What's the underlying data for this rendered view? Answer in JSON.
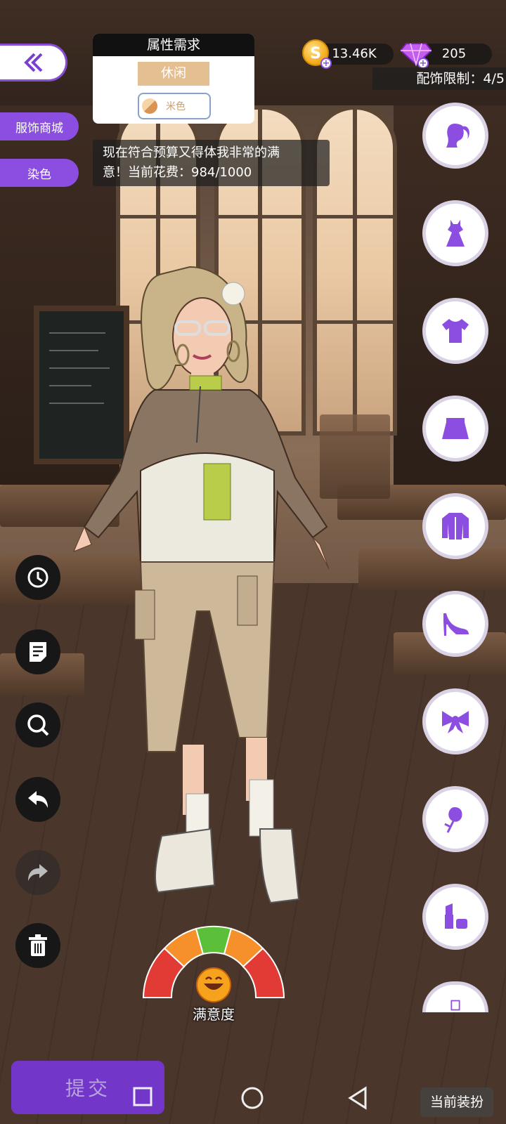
{
  "colors": {
    "accent": "#8b4ee0",
    "submit_bg": "#7236c9",
    "tag_bg": "#e3bf92"
  },
  "requirement": {
    "title": "属性需求",
    "style_tag": "休闲",
    "color_label": "米色"
  },
  "sidebar": {
    "shop_label": "服饰商城",
    "dye_label": "染色"
  },
  "message": {
    "line1": "现在符合预算又得体我非常的满",
    "line2": "意！当前花费：984/1000"
  },
  "currency": {
    "coins": "13.46K",
    "gems": "205",
    "coin_symbol": "S"
  },
  "accessory_limit": "配饰限制：4/5",
  "categories": [
    "hair-icon",
    "dress-icon",
    "top-icon",
    "skirt-icon",
    "jacket-icon",
    "shoe-icon",
    "bow-icon",
    "rose-icon",
    "makeup-icon",
    "more-icon"
  ],
  "tools": [
    "history-icon",
    "notes-icon",
    "zoom-icon",
    "undo-icon",
    "redo-icon",
    "trash-icon"
  ],
  "gauge": {
    "label": "满意度",
    "level": 0.52
  },
  "bottom": {
    "submit_label": "提交",
    "current_outfit_label": "当前装扮"
  }
}
